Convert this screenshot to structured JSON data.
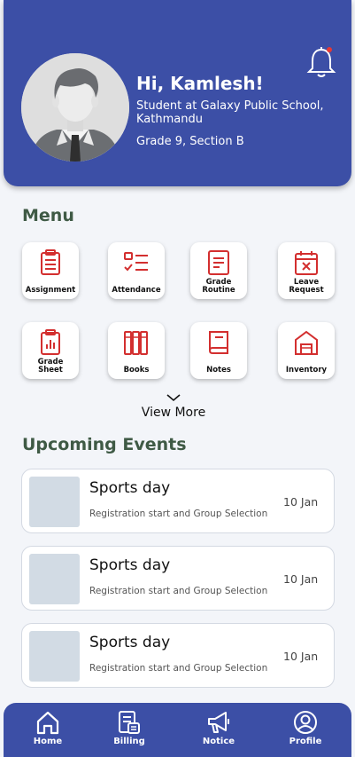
{
  "header": {
    "greeting": "Hi, Kamlesh!",
    "role": "Student at Galaxy Public School, Kathmandu",
    "grade": "Grade 9, Section B",
    "notification_dot_color": "#e53935"
  },
  "menu": {
    "title": "Menu",
    "items": [
      {
        "label": "Assignment",
        "icon": "clipboard-icon"
      },
      {
        "label": "Attendance",
        "icon": "checklist-icon"
      },
      {
        "label": "Grade\nRoutine",
        "icon": "document-icon"
      },
      {
        "label": "Leave\nRequest",
        "icon": "calendar-x-icon"
      },
      {
        "label": "Grade\nSheet",
        "icon": "report-icon"
      },
      {
        "label": "Books",
        "icon": "books-icon"
      },
      {
        "label": "Notes",
        "icon": "notebook-icon"
      },
      {
        "label": "Inventory",
        "icon": "warehouse-icon"
      }
    ],
    "view_more": "View More"
  },
  "events": {
    "title": "Upcoming Events",
    "items": [
      {
        "title": "Sports day",
        "description": "Registration start and Group Selection",
        "date": "10 Jan"
      },
      {
        "title": "Sports day",
        "description": "Registration start and Group Selection",
        "date": "10 Jan"
      },
      {
        "title": "Sports day",
        "description": "Registration start and Group Selection",
        "date": "10 Jan"
      }
    ]
  },
  "nav": {
    "items": [
      {
        "label": "Home",
        "icon": "home-icon"
      },
      {
        "label": "Billing",
        "icon": "bill-icon"
      },
      {
        "label": "Notice",
        "icon": "megaphone-icon"
      },
      {
        "label": "Profile",
        "icon": "profile-icon"
      }
    ]
  },
  "colors": {
    "primary": "#3c4fa6",
    "icon_red": "#d32f2f",
    "section_title": "#3f5a45",
    "background": "#f3f5f9"
  }
}
